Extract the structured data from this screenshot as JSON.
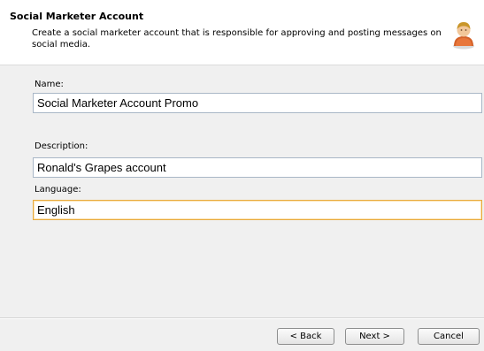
{
  "header": {
    "title": "Social Marketer Account",
    "description": "Create a social marketer account that is responsible for approving and posting messages on social media."
  },
  "form": {
    "name_label": "Name:",
    "name_value": "Social Marketer Account Promo",
    "description_label": "Description:",
    "description_value": "Ronald's Grapes account",
    "language_label": "Language:",
    "language_value": "English"
  },
  "buttons": {
    "back": "< Back",
    "next": "Next >",
    "cancel": "Cancel"
  },
  "icons": {
    "header_icon": "user-icon"
  },
  "colors": {
    "focus_border": "#e8ab3e",
    "header_bg": "#ffffff",
    "panel_bg": "#f0f0f0"
  }
}
